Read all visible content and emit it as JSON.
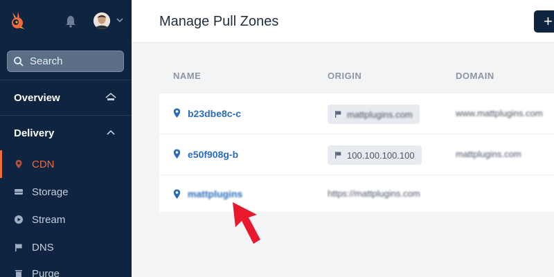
{
  "sidebar": {
    "search": {
      "placeholder": "Search"
    },
    "sections": [
      {
        "label": "Overview",
        "icon": "home-icon"
      },
      {
        "label": "Delivery",
        "icon": "chevron-up-icon"
      }
    ],
    "items": [
      {
        "label": "CDN",
        "icon": "map-pin-icon",
        "active": true
      },
      {
        "label": "Storage",
        "icon": "drive-icon"
      },
      {
        "label": "Stream",
        "icon": "play-icon"
      },
      {
        "label": "DNS",
        "icon": "flag-icon"
      },
      {
        "label": "Purge",
        "icon": "trash-icon"
      }
    ]
  },
  "header": {
    "title": "Manage Pull Zones",
    "add_label": "+"
  },
  "table": {
    "columns": [
      "NAME",
      "ORIGIN",
      "DOMAIN"
    ],
    "rows": [
      {
        "name": "b23dbe8c-c",
        "origin": "mattplugins.com",
        "domain": "www.mattplugins.com"
      },
      {
        "name": "e50f908g-b",
        "origin": "100.100.100.100",
        "domain": "mattplugins.com"
      },
      {
        "name": "mattplugins",
        "origin": "https://mattplugins.com",
        "domain": ""
      }
    ]
  },
  "colors": {
    "sidebar_bg": "#0e2440",
    "accent": "#f26a3d",
    "link": "#2a6bbd",
    "annotation_arrow": "#e8192c"
  }
}
